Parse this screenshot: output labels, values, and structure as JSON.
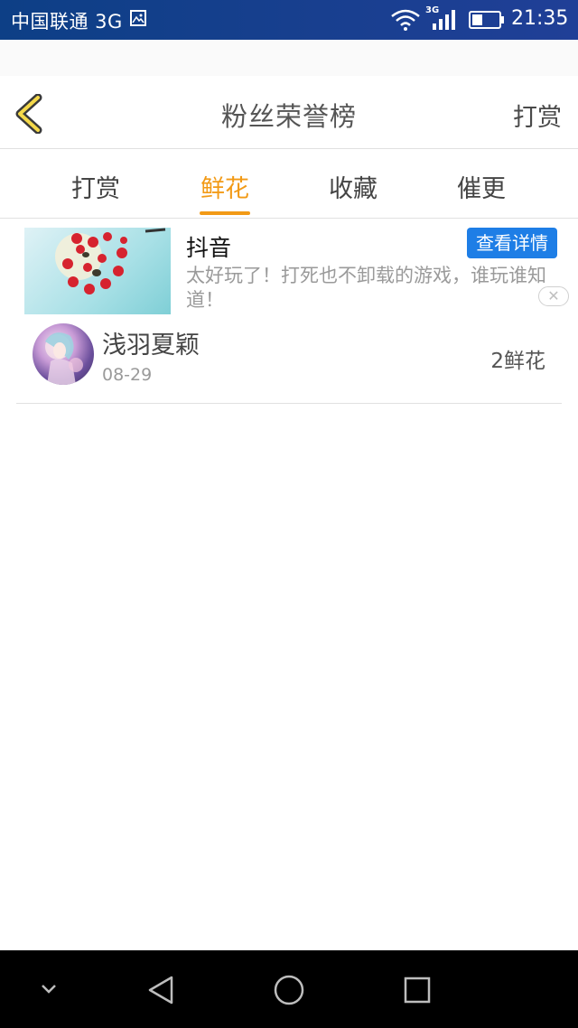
{
  "status_bar": {
    "carrier": "中国联通 3G",
    "network_type": "3G",
    "time": "21:35"
  },
  "header": {
    "title": "粉丝荣誉榜",
    "action_label": "打赏"
  },
  "tabs": [
    {
      "label": "打赏",
      "active": false
    },
    {
      "label": "鲜花",
      "active": true
    },
    {
      "label": "收藏",
      "active": false
    },
    {
      "label": "催更",
      "active": false
    }
  ],
  "ad": {
    "title": "抖音",
    "description": "太好玩了！打死也不卸载的游戏，谁玩谁知道！",
    "button_label": "查看详情",
    "close_icon": "close-icon"
  },
  "fans": [
    {
      "name": "浅羽夏颖",
      "date": "08-29",
      "amount": "2鲜花"
    }
  ],
  "colors": {
    "accent": "#f29a16",
    "ad_button": "#1e7ee6",
    "status_bar": "#173f8e"
  }
}
